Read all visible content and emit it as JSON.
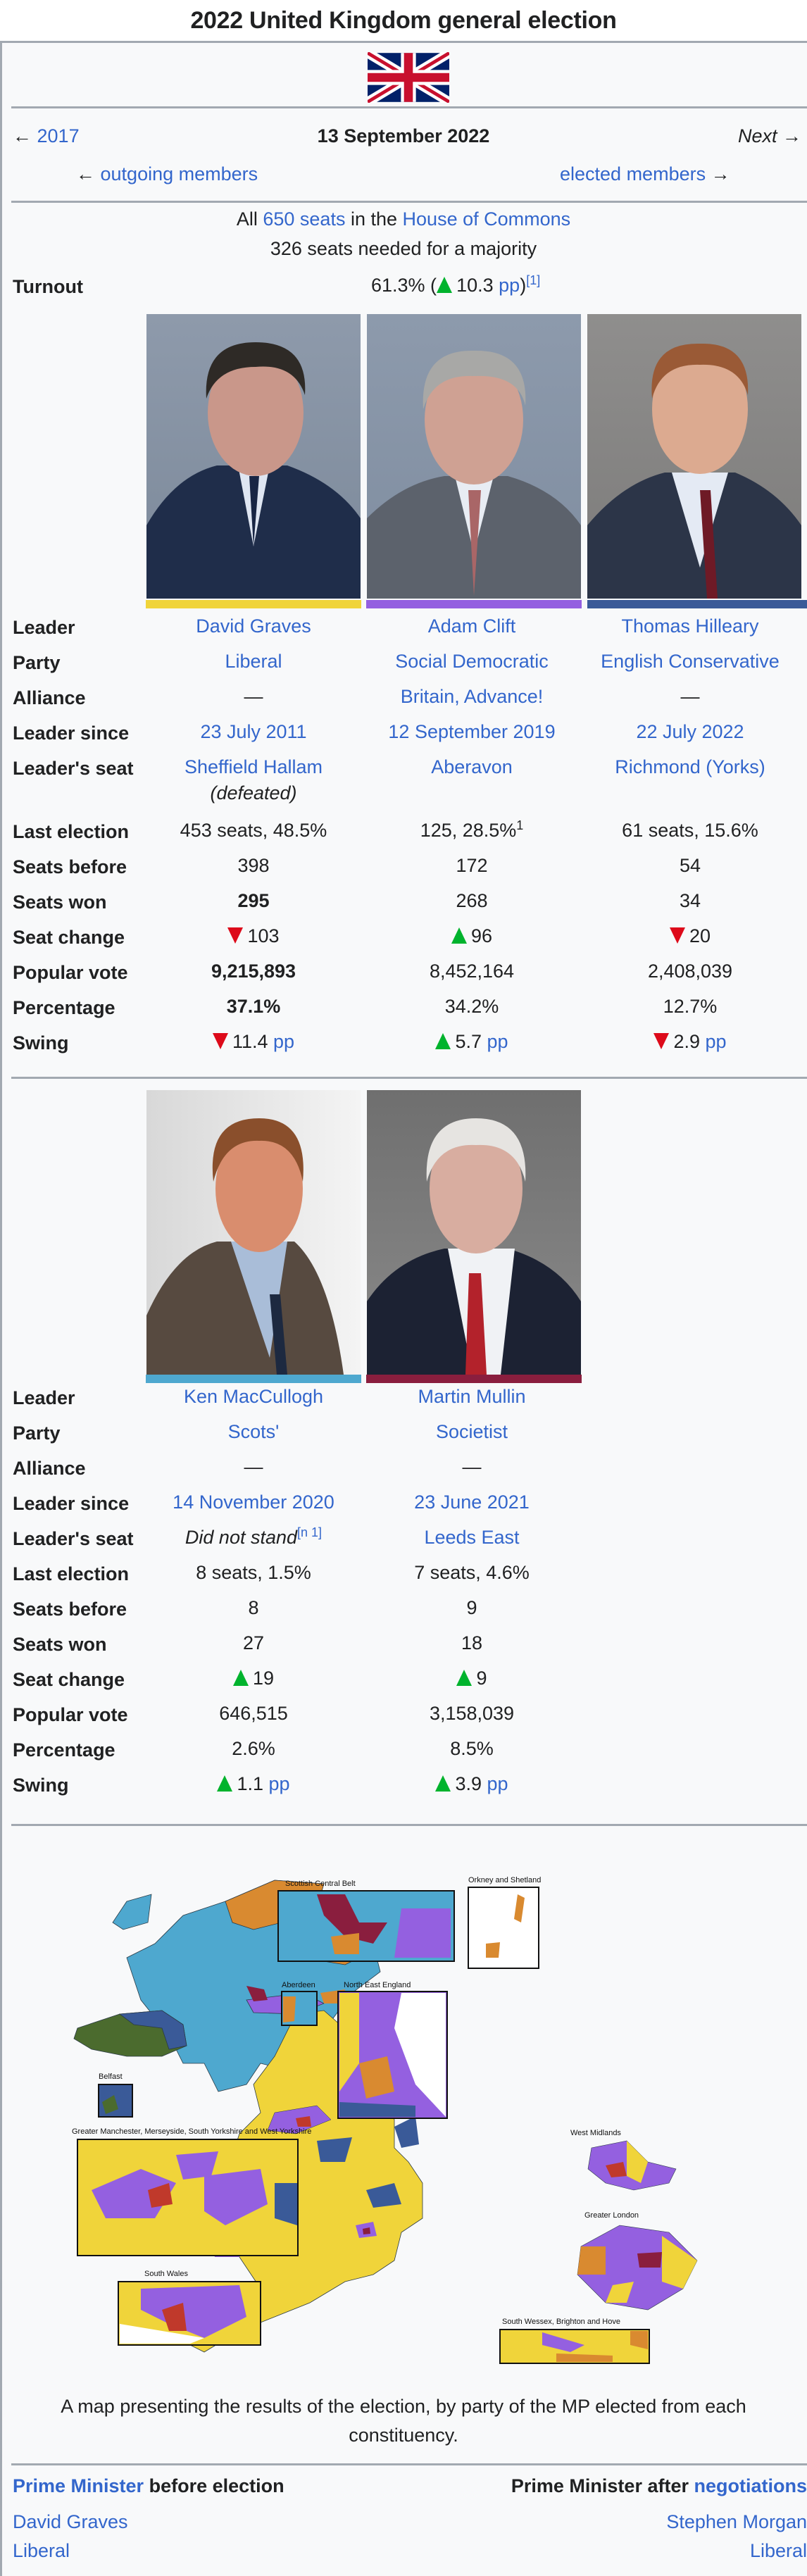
{
  "title": "2022 United Kingdom general election",
  "flag_icon": "union-jack-flag",
  "nav": {
    "prev_arrow": "←",
    "prev_label": "2017",
    "date": "13 September 2022",
    "next_label": "Next",
    "next_arrow": "→",
    "outgoing_arrow": "←",
    "outgoing_label": "outgoing members",
    "elected_label": "elected members",
    "elected_arrow": "→"
  },
  "summary": {
    "all": "All",
    "seats_link": "650 seats",
    "in_the": "in the",
    "house_link": "House of Commons",
    "majority": "326 seats needed for a majority",
    "turnout_label": "Turnout",
    "turnout_value": "61.3% (",
    "turnout_change": "10.3",
    "turnout_pp": "pp",
    "turnout_close": ")",
    "turnout_ref": "[1]"
  },
  "row_labels": {
    "leader": "Leader",
    "party": "Party",
    "alliance": "Alliance",
    "leader_since": "Leader since",
    "leaders_seat": "Leader's seat",
    "last_election": "Last election",
    "seats_before": "Seats before",
    "seats_won": "Seats won",
    "seat_change": "Seat change",
    "popular_vote": "Popular vote",
    "percentage": "Percentage",
    "swing": "Swing"
  },
  "parties_top": [
    {
      "color": "#f0d43a",
      "leader": "David Graves",
      "party": "Liberal",
      "alliance": "—",
      "leader_since": "23 July 2011",
      "leaders_seat": "Sheffield Hallam",
      "leaders_seat_note": "(defeated)",
      "last_election": "453 seats, 48.5%",
      "last_election_sup": "",
      "seats_before": "398",
      "seats_won": "295",
      "seat_change_dir": "down",
      "seat_change": "103",
      "popular_vote": "9,215,893",
      "percentage": "37.1%",
      "swing_dir": "down",
      "swing": "11.4",
      "swing_unit": "pp"
    },
    {
      "color": "#9460e0",
      "leader": "Adam Clift",
      "party": "Social Democratic",
      "alliance": "Britain, Advance!",
      "leader_since": "12 September 2019",
      "leaders_seat": "Aberavon",
      "leaders_seat_note": "",
      "last_election": "125, 28.5%",
      "last_election_sup": "1",
      "seats_before": "172",
      "seats_won": "268",
      "seat_change_dir": "up",
      "seat_change": "96",
      "popular_vote": "8,452,164",
      "percentage": "34.2%",
      "swing_dir": "up",
      "swing": "5.7",
      "swing_unit": "pp"
    },
    {
      "color": "#3a5a98",
      "leader": "Thomas Hilleary",
      "party": "English Conservative",
      "alliance": "—",
      "leader_since": "22 July 2022",
      "leaders_seat": "Richmond (Yorks)",
      "leaders_seat_note": "",
      "last_election": "61 seats, 15.6%",
      "last_election_sup": "",
      "seats_before": "54",
      "seats_won": "34",
      "seat_change_dir": "down",
      "seat_change": "20",
      "popular_vote": "2,408,039",
      "percentage": "12.7%",
      "swing_dir": "down",
      "swing": "2.9",
      "swing_unit": "pp"
    }
  ],
  "parties_bottom": [
    {
      "color": "#4ea8cf",
      "leader": "Ken MacCullogh",
      "party": "Scots'",
      "alliance": "—",
      "leader_since": "14 November 2020",
      "leaders_seat": "Did not stand",
      "leaders_seat_ref": "[n 1]",
      "last_election": "8 seats, 1.5%",
      "seats_before": "8",
      "seats_won": "27",
      "seat_change_dir": "up",
      "seat_change": "19",
      "popular_vote": "646,515",
      "percentage": "2.6%",
      "swing_dir": "up",
      "swing": "1.1",
      "swing_unit": "pp"
    },
    {
      "color": "#8a1e3e",
      "leader": "Martin Mullin",
      "party": "Societist",
      "alliance": "—",
      "leader_since": "23 June 2021",
      "leaders_seat": "Leeds East",
      "leaders_seat_ref": "",
      "last_election": "7 seats, 4.6%",
      "seats_before": "9",
      "seats_won": "18",
      "seat_change_dir": "up",
      "seat_change": "9",
      "popular_vote": "3,158,039",
      "percentage": "8.5%",
      "swing_dir": "up",
      "swing": "3.9",
      "swing_unit": "pp"
    }
  ],
  "map": {
    "insets": {
      "scottish_central_belt": "Scottish Central Belt",
      "orkney_shetland": "Orkney and Shetland",
      "aberdeen": "Aberdeen",
      "north_east_england": "North East England",
      "belfast": "Belfast",
      "greater_manchester": "Greater Manchester, Merseyside, South Yorkshire and West Yorkshire",
      "west_midlands": "West Midlands",
      "greater_london": "Greater London",
      "south_wales": "South Wales",
      "south_wessex": "South Wessex, Brighton and Hove"
    },
    "caption": "A map presenting the results of the election, by party of the MP elected from each constituency."
  },
  "pm": {
    "before_link": "Prime Minister",
    "before_text": "before election",
    "after_text": "Prime Minister after",
    "after_link": "negotiations",
    "before_name": "David Graves",
    "before_party": "Liberal",
    "after_name": "Stephen Morgan",
    "after_party": "Liberal"
  }
}
